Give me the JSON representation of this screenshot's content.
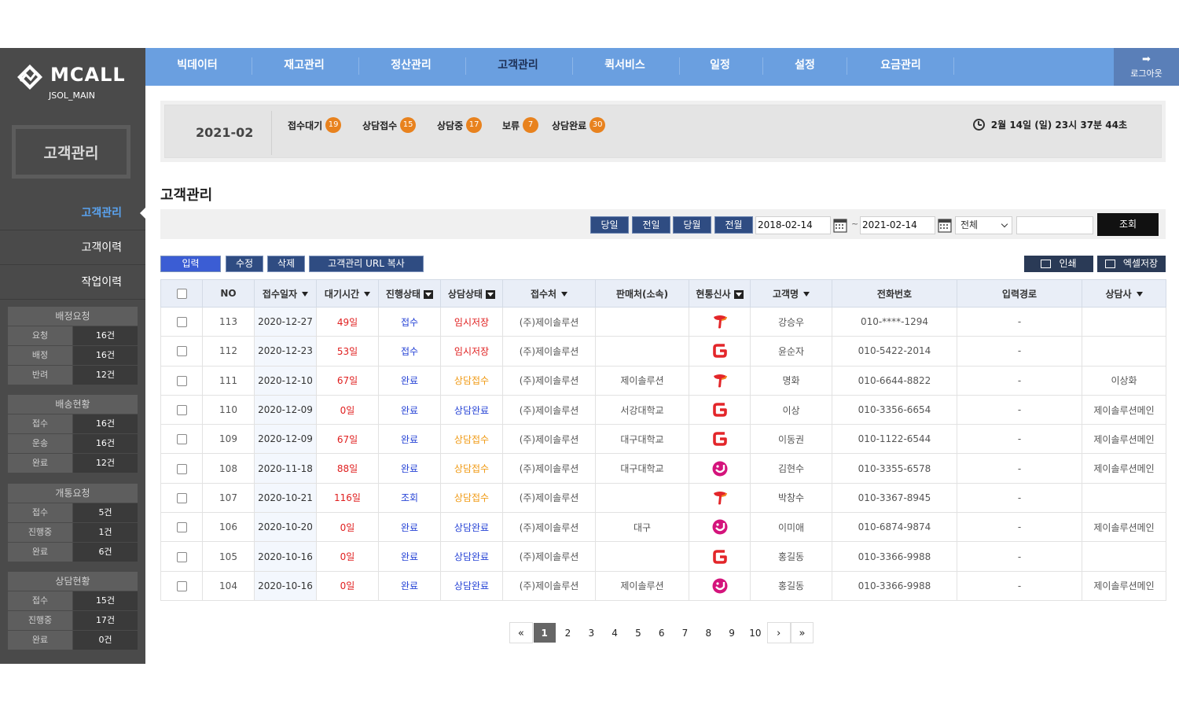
{
  "app": {
    "logo": "MCALL",
    "sub": "JSOL_MAIN"
  },
  "sidebar": {
    "title": "고객관리",
    "menu": [
      {
        "label": "고객관리",
        "active": true
      },
      {
        "label": "고객이력",
        "active": false
      },
      {
        "label": "작업이력",
        "active": false
      }
    ],
    "groups": [
      {
        "title": "배정요청",
        "rows": [
          {
            "k": "요청",
            "v": "16건"
          },
          {
            "k": "배정",
            "v": "16건"
          },
          {
            "k": "반려",
            "v": "12건"
          }
        ]
      },
      {
        "title": "배송현황",
        "rows": [
          {
            "k": "접수",
            "v": "16건"
          },
          {
            "k": "운송",
            "v": "16건"
          },
          {
            "k": "완료",
            "v": "12건"
          }
        ]
      },
      {
        "title": "개통요청",
        "rows": [
          {
            "k": "접수",
            "v": "5건"
          },
          {
            "k": "진행중",
            "v": "1건"
          },
          {
            "k": "완료",
            "v": "6건"
          }
        ]
      },
      {
        "title": "상담현황",
        "rows": [
          {
            "k": "접수",
            "v": "15건"
          },
          {
            "k": "진행중",
            "v": "17건"
          },
          {
            "k": "완료",
            "v": "0건"
          }
        ]
      }
    ]
  },
  "topnav": {
    "tabs": [
      {
        "label": "빅데이터",
        "active": false
      },
      {
        "label": "재고관리",
        "active": false
      },
      {
        "label": "정산관리",
        "active": false
      },
      {
        "label": "고객관리",
        "active": true
      },
      {
        "label": "퀵서비스",
        "active": false
      },
      {
        "label": "일정",
        "active": false
      },
      {
        "label": "설정",
        "active": false
      },
      {
        "label": "요금관리",
        "active": false
      }
    ],
    "logout": "로그아웃"
  },
  "banner": {
    "period": "2021-02",
    "stats": [
      {
        "label": "접수대기",
        "count": "19"
      },
      {
        "label": "상담접수",
        "count": "15"
      },
      {
        "label": "상담중",
        "count": "17"
      },
      {
        "label": "보류",
        "count": "7"
      },
      {
        "label": "상담완료",
        "count": "30"
      }
    ],
    "datetime": "2월 14일 (일) 23시 37분 44초"
  },
  "page_title": "고객관리",
  "filter": {
    "buttons": [
      "당일",
      "전일",
      "당월",
      "전월"
    ],
    "date_from": "2018-02-14",
    "tilde": "~",
    "date_to": "2021-02-14",
    "select_value": "전체",
    "search_value": "",
    "search_label": "조회"
  },
  "actions": {
    "input": "입력",
    "edit": "수정",
    "delete": "삭제",
    "copy_url": "고객관리 URL 복사",
    "print": "인쇄",
    "excel": "엑셀저장"
  },
  "table": {
    "headers": [
      "NO",
      "접수일자",
      "대기시간",
      "진행상태",
      "상담상태",
      "접수처",
      "판매처(소속)",
      "현통신사",
      "고객명",
      "전화번호",
      "입력경로",
      "상담사"
    ],
    "rows": [
      {
        "no": "113",
        "date": "2020-12-27",
        "wait": "49일",
        "prog": "접수",
        "cs": "임시저장",
        "cs_type": "temp",
        "recv": "(주)제이솔루션",
        "seller": "",
        "carrier": "skt",
        "name": "강승우",
        "phone": "010-****-1294",
        "path": "-",
        "agent": ""
      },
      {
        "no": "112",
        "date": "2020-12-23",
        "wait": "53일",
        "prog": "접수",
        "cs": "임시저장",
        "cs_type": "temp",
        "recv": "(주)제이솔루션",
        "seller": "",
        "carrier": "kt",
        "name": "윤순자",
        "phone": "010-5422-2014",
        "path": "-",
        "agent": ""
      },
      {
        "no": "111",
        "date": "2020-12-10",
        "wait": "67일",
        "prog": "완료",
        "cs": "상담접수",
        "cs_type": "recv",
        "recv": "(주)제이솔루션",
        "seller": "제이솔루션",
        "carrier": "skt",
        "name": "명화",
        "phone": "010-6644-8822",
        "path": "-",
        "agent": "이상화"
      },
      {
        "no": "110",
        "date": "2020-12-09",
        "wait": "0일",
        "prog": "완료",
        "cs": "상담완료",
        "cs_type": "done",
        "recv": "(주)제이솔루션",
        "seller": "서강대학교",
        "carrier": "kt",
        "name": "이상",
        "phone": "010-3356-6654",
        "path": "-",
        "agent": "제이솔루션메인"
      },
      {
        "no": "109",
        "date": "2020-12-09",
        "wait": "67일",
        "prog": "완료",
        "cs": "상담접수",
        "cs_type": "recv",
        "recv": "(주)제이솔루션",
        "seller": "대구대학교",
        "carrier": "kt",
        "name": "이동권",
        "phone": "010-1122-6544",
        "path": "-",
        "agent": "제이솔루션메인"
      },
      {
        "no": "108",
        "date": "2020-11-18",
        "wait": "88일",
        "prog": "완료",
        "cs": "상담접수",
        "cs_type": "recv",
        "recv": "(주)제이솔루션",
        "seller": "대구대학교",
        "carrier": "lgu",
        "name": "김현수",
        "phone": "010-3355-6578",
        "path": "-",
        "agent": "제이솔루션메인"
      },
      {
        "no": "107",
        "date": "2020-10-21",
        "wait": "116일",
        "prog": "조회",
        "cs": "상담접수",
        "cs_type": "recv",
        "recv": "(주)제이솔루션",
        "seller": "",
        "carrier": "skt",
        "name": "박창수",
        "phone": "010-3367-8945",
        "path": "-",
        "agent": ""
      },
      {
        "no": "106",
        "date": "2020-10-20",
        "wait": "0일",
        "prog": "완료",
        "cs": "상담완료",
        "cs_type": "done",
        "recv": "(주)제이솔루션",
        "seller": "대구",
        "carrier": "lgu",
        "name": "이미애",
        "phone": "010-6874-9874",
        "path": "-",
        "agent": "제이솔루션메인"
      },
      {
        "no": "105",
        "date": "2020-10-16",
        "wait": "0일",
        "prog": "완료",
        "cs": "상담완료",
        "cs_type": "done",
        "recv": "(주)제이솔루션",
        "seller": "",
        "carrier": "kt",
        "name": "홍길동",
        "phone": "010-3366-9988",
        "path": "-",
        "agent": ""
      },
      {
        "no": "104",
        "date": "2020-10-16",
        "wait": "0일",
        "prog": "완료",
        "cs": "상담완료",
        "cs_type": "done",
        "recv": "(주)제이솔루션",
        "seller": "제이솔루션",
        "carrier": "lgu",
        "name": "홍길동",
        "phone": "010-3366-9988",
        "path": "-",
        "agent": "제이솔루션메인"
      }
    ]
  },
  "pagination": {
    "first": "«",
    "prev": "‹",
    "pages": [
      "1",
      "2",
      "3",
      "4",
      "5",
      "6",
      "7",
      "8",
      "9",
      "10"
    ],
    "current": "1",
    "next": "›",
    "last": "»"
  },
  "colors": {
    "nav": "#6a9fe0",
    "sidebar": "#4a4a4a",
    "button": "#2f4c82",
    "badge": "#e8821e",
    "warn": "#e02020",
    "link": "#2744d6"
  },
  "icons": {
    "calendar": "calendar-icon",
    "clock": "clock-icon",
    "logout": "logout-icon",
    "print": "printer-icon",
    "excel": "excel-icon"
  }
}
